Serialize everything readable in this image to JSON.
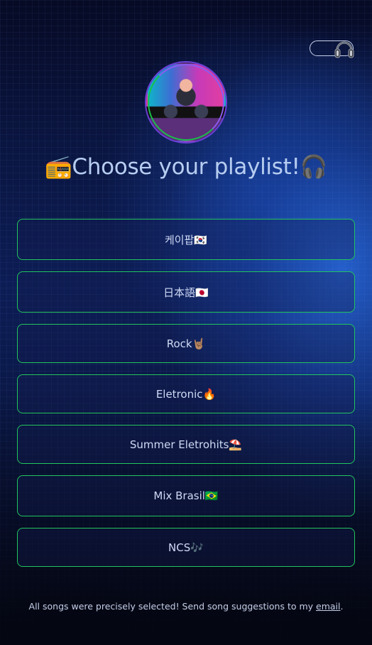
{
  "header": {
    "toggle_icon": "headphones-icon",
    "avatar_alt": "dj-avatar"
  },
  "title": {
    "prefix_emoji": "📻",
    "text": "Choose your playlist!",
    "suffix_emoji": "🎧"
  },
  "playlists": [
    {
      "label": "케이팝🇰🇷"
    },
    {
      "label": "日本語🇯🇵"
    },
    {
      "label": "Rock🤘🏽"
    },
    {
      "label": "Eletronic🔥"
    },
    {
      "label": "Summer Eletrohits⛱️"
    },
    {
      "label": "Mix Brasil🇧🇷"
    },
    {
      "label": "NCS🎶"
    }
  ],
  "footer": {
    "text": "All songs were precisely selected! Send song suggestions to my ",
    "link_label": "email",
    "end": "."
  },
  "colors": {
    "accent_border": "#22c55e",
    "title_text": "#b7cdf1",
    "background": "#0a1640"
  }
}
